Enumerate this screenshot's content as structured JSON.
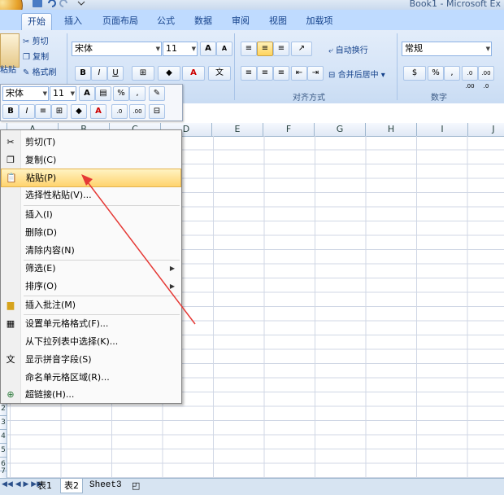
{
  "window": {
    "title": "Book1 - Microsoft Ex"
  },
  "tabs": [
    "开始",
    "插入",
    "页面布局",
    "公式",
    "数据",
    "审阅",
    "视图",
    "加载项"
  ],
  "ribbon": {
    "clipboard": {
      "paste": "粘贴",
      "cut": "剪切",
      "copy": "复制",
      "format_painter": "格式刷"
    },
    "font": {
      "name": "宋体",
      "size": "11",
      "bold": "B",
      "italic": "I",
      "underline": "U",
      "grow": "A",
      "shrink": "A",
      "color_letter": "A",
      "phonetic": "文"
    },
    "alignment": {
      "wrap_text": "自动换行",
      "merge_center": "合并后居中",
      "label": "对齐方式"
    },
    "number": {
      "format": "常规",
      "percent": "%",
      "comma": ",",
      "inc_dec": ".0 .00",
      "dec_dec": ".00 .0",
      "label": "数字"
    }
  },
  "mini_toolbar": {
    "font": "宋体",
    "size": "11",
    "bold": "B",
    "italic": "I",
    "percent": "%",
    "comma": ","
  },
  "columns": [
    "A",
    "B",
    "C",
    "D",
    "E",
    "F",
    "G",
    "H",
    "I",
    "J"
  ],
  "rows_visible": [
    "2",
    "3",
    "4",
    "5",
    "6",
    "7"
  ],
  "context_menu": [
    {
      "label": "剪切(T)",
      "icon": "scissors-icon",
      "submenu": false
    },
    {
      "label": "复制(C)",
      "icon": "copy-icon",
      "submenu": false
    },
    {
      "label": "粘贴(P)",
      "icon": "paste-icon",
      "submenu": false,
      "highlighted": true
    },
    {
      "label": "选择性粘贴(V)...",
      "icon": "",
      "submenu": false
    },
    {
      "label": "插入(I)",
      "icon": "",
      "submenu": false
    },
    {
      "label": "删除(D)",
      "icon": "",
      "submenu": false
    },
    {
      "label": "清除内容(N)",
      "icon": "",
      "submenu": false
    },
    {
      "label": "筛选(E)",
      "icon": "",
      "submenu": true
    },
    {
      "label": "排序(O)",
      "icon": "",
      "submenu": true
    },
    {
      "label": "插入批注(M)",
      "icon": "comment-icon",
      "submenu": false
    },
    {
      "label": "设置单元格格式(F)...",
      "icon": "format-cells-icon",
      "submenu": false
    },
    {
      "label": "从下拉列表中选择(K)...",
      "icon": "",
      "submenu": false
    },
    {
      "label": "显示拼音字段(S)",
      "icon": "phonetic-icon",
      "submenu": false
    },
    {
      "label": "命名单元格区域(R)...",
      "icon": "",
      "submenu": false
    },
    {
      "label": "超链接(H)...",
      "icon": "hyperlink-icon",
      "submenu": false
    }
  ],
  "sheets": [
    "表1",
    "表2",
    "Sheet3"
  ],
  "colors": {
    "accent": "#15428b",
    "annotation_arrow": "#e53935",
    "highlight": "#ffd36d"
  }
}
